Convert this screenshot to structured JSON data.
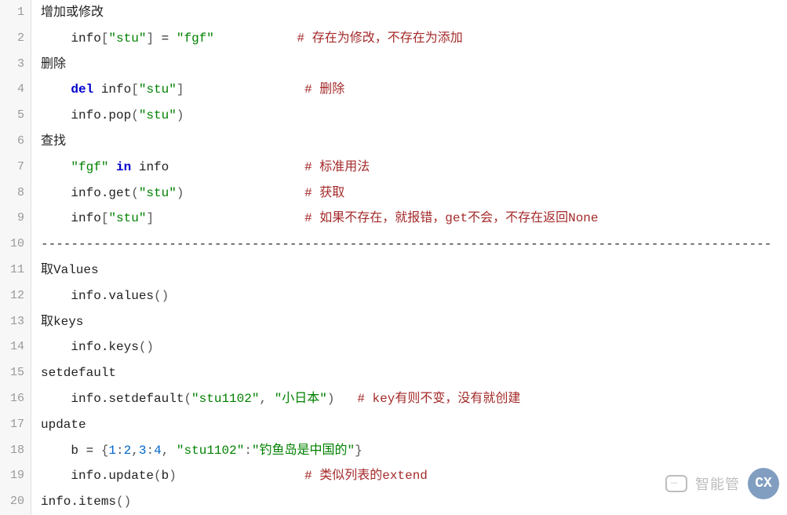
{
  "lines": [
    {
      "n": 1,
      "segs": [
        {
          "t": "增加或修改",
          "c": "id"
        }
      ]
    },
    {
      "n": 2,
      "segs": [
        {
          "t": "    ",
          "c": "id"
        },
        {
          "t": "info",
          "c": "id"
        },
        {
          "t": "[",
          "c": "punc"
        },
        {
          "t": "\"stu\"",
          "c": "str"
        },
        {
          "t": "]",
          "c": "punc"
        },
        {
          "t": " = ",
          "c": "id"
        },
        {
          "t": "\"fgf\"",
          "c": "str"
        },
        {
          "t": "           ",
          "c": "id"
        },
        {
          "t": "# 存在为修改，不存在为添加",
          "c": "cmt"
        }
      ]
    },
    {
      "n": 3,
      "segs": [
        {
          "t": "删除",
          "c": "id"
        }
      ]
    },
    {
      "n": 4,
      "segs": [
        {
          "t": "    ",
          "c": "id"
        },
        {
          "t": "del",
          "c": "kw"
        },
        {
          "t": " info",
          "c": "id"
        },
        {
          "t": "[",
          "c": "punc"
        },
        {
          "t": "\"stu\"",
          "c": "str"
        },
        {
          "t": "]",
          "c": "punc"
        },
        {
          "t": "                ",
          "c": "id"
        },
        {
          "t": "# 删除",
          "c": "cmt"
        }
      ]
    },
    {
      "n": 5,
      "segs": [
        {
          "t": "    ",
          "c": "id"
        },
        {
          "t": "info.pop",
          "c": "id"
        },
        {
          "t": "(",
          "c": "punc"
        },
        {
          "t": "\"stu\"",
          "c": "str"
        },
        {
          "t": ")",
          "c": "punc"
        }
      ]
    },
    {
      "n": 6,
      "segs": [
        {
          "t": "查找",
          "c": "id"
        }
      ]
    },
    {
      "n": 7,
      "segs": [
        {
          "t": "    ",
          "c": "id"
        },
        {
          "t": "\"fgf\"",
          "c": "str"
        },
        {
          "t": " ",
          "c": "id"
        },
        {
          "t": "in",
          "c": "kw"
        },
        {
          "t": " info",
          "c": "id"
        },
        {
          "t": "                  ",
          "c": "id"
        },
        {
          "t": "# 标准用法",
          "c": "cmt"
        }
      ]
    },
    {
      "n": 8,
      "segs": [
        {
          "t": "    ",
          "c": "id"
        },
        {
          "t": "info.get",
          "c": "id"
        },
        {
          "t": "(",
          "c": "punc"
        },
        {
          "t": "\"stu\"",
          "c": "str"
        },
        {
          "t": ")",
          "c": "punc"
        },
        {
          "t": "                ",
          "c": "id"
        },
        {
          "t": "# 获取",
          "c": "cmt"
        }
      ]
    },
    {
      "n": 9,
      "segs": [
        {
          "t": "    ",
          "c": "id"
        },
        {
          "t": "info",
          "c": "id"
        },
        {
          "t": "[",
          "c": "punc"
        },
        {
          "t": "\"stu\"",
          "c": "str"
        },
        {
          "t": "]",
          "c": "punc"
        },
        {
          "t": "                    ",
          "c": "id"
        },
        {
          "t": "# 如果不存在，就报错，get不会，不存在返回None",
          "c": "cmt"
        }
      ]
    },
    {
      "n": 10,
      "segs": [
        {
          "t": "-------------------------------------------------------------------------------------------------",
          "c": "id"
        }
      ]
    },
    {
      "n": 11,
      "segs": [
        {
          "t": "取Values",
          "c": "id"
        }
      ]
    },
    {
      "n": 12,
      "segs": [
        {
          "t": "    ",
          "c": "id"
        },
        {
          "t": "info.values",
          "c": "id"
        },
        {
          "t": "()",
          "c": "punc"
        }
      ]
    },
    {
      "n": 13,
      "segs": [
        {
          "t": "取keys",
          "c": "id"
        }
      ]
    },
    {
      "n": 14,
      "segs": [
        {
          "t": "    ",
          "c": "id"
        },
        {
          "t": "info.keys",
          "c": "id"
        },
        {
          "t": "()",
          "c": "punc"
        }
      ]
    },
    {
      "n": 15,
      "segs": [
        {
          "t": "setdefault",
          "c": "id"
        }
      ]
    },
    {
      "n": 16,
      "segs": [
        {
          "t": "    ",
          "c": "id"
        },
        {
          "t": "info.setdefault",
          "c": "id"
        },
        {
          "t": "(",
          "c": "punc"
        },
        {
          "t": "\"stu1102\"",
          "c": "str"
        },
        {
          "t": ",",
          "c": "punc"
        },
        {
          "t": " ",
          "c": "id"
        },
        {
          "t": "\"小日本\"",
          "c": "str"
        },
        {
          "t": ")",
          "c": "punc"
        },
        {
          "t": "   ",
          "c": "id"
        },
        {
          "t": "# key有则不变，没有就创建",
          "c": "cmt"
        }
      ]
    },
    {
      "n": 17,
      "segs": [
        {
          "t": "update",
          "c": "id"
        }
      ]
    },
    {
      "n": 18,
      "segs": [
        {
          "t": "    ",
          "c": "id"
        },
        {
          "t": "b = ",
          "c": "id"
        },
        {
          "t": "{",
          "c": "punc"
        },
        {
          "t": "1",
          "c": "num"
        },
        {
          "t": ":",
          "c": "punc"
        },
        {
          "t": "2",
          "c": "num"
        },
        {
          "t": ",",
          "c": "punc"
        },
        {
          "t": "3",
          "c": "num"
        },
        {
          "t": ":",
          "c": "punc"
        },
        {
          "t": "4",
          "c": "num"
        },
        {
          "t": ",",
          "c": "punc"
        },
        {
          "t": " ",
          "c": "id"
        },
        {
          "t": "\"stu1102\"",
          "c": "str"
        },
        {
          "t": ":",
          "c": "punc"
        },
        {
          "t": "\"钓鱼岛是中国的\"",
          "c": "str"
        },
        {
          "t": "}",
          "c": "punc"
        }
      ]
    },
    {
      "n": 19,
      "segs": [
        {
          "t": "    ",
          "c": "id"
        },
        {
          "t": "info.update",
          "c": "id"
        },
        {
          "t": "(",
          "c": "punc"
        },
        {
          "t": "b",
          "c": "id"
        },
        {
          "t": ")",
          "c": "punc"
        },
        {
          "t": "                 ",
          "c": "id"
        },
        {
          "t": "# 类似列表的extend",
          "c": "cmt"
        }
      ]
    },
    {
      "n": 20,
      "segs": [
        {
          "t": "info.items",
          "c": "id"
        },
        {
          "t": "()",
          "c": "punc"
        }
      ]
    }
  ],
  "watermark": {
    "text1": "智能管",
    "logo": "创新互联"
  }
}
